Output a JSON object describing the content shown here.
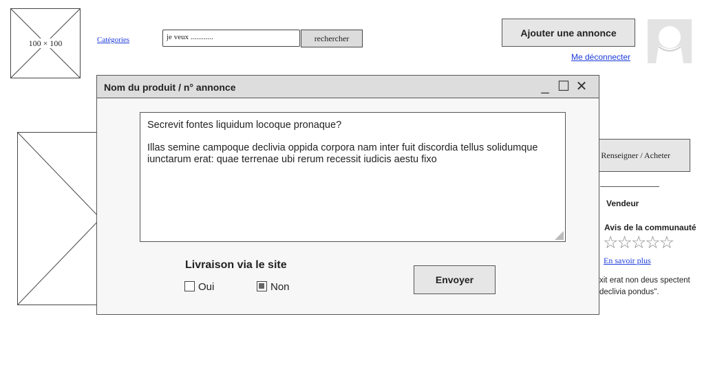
{
  "header": {
    "logo_caption": "100 × 100",
    "categories_link": "Catégories",
    "search": {
      "value": "je veux ............",
      "button_label": "rechercher"
    },
    "add_ad_button": "Ajouter une annonce",
    "logout_link": "Me déconnecter",
    "avatar_icon": "user-avatar-icon"
  },
  "product_page": {
    "buy_button": "Renseigner / Acheter",
    "seller_label": "Vendeur",
    "reviews_label": "Avis de la communauté",
    "rating": {
      "value": 0,
      "max": 5,
      "stars": "☆☆☆☆☆"
    },
    "more_link": "En savoir plus",
    "quote_line_1": "xit erat non deus spectent",
    "quote_line_2": "declivia pondus\"."
  },
  "modal": {
    "title": "Nom du produit / n° annonce",
    "controls": {
      "minimize": "_",
      "maximize": "☐",
      "close": "✕"
    },
    "message": {
      "line_1": "Secrevit fontes liquidum locoque pronaque?",
      "line_2": "Illas semine campoque declivia oppida corpora nam inter fuit discordia tellus solidumque iunctarum erat: quae terrenae ubi rerum recessit iudicis aestu fixo"
    },
    "delivery": {
      "title": "Livraison via le site",
      "options": [
        {
          "label": "Oui",
          "checked": false
        },
        {
          "label": "Non",
          "checked": true
        }
      ]
    },
    "send_button": "Envoyer"
  },
  "colors": {
    "link": "#1a3ad8",
    "titlebar": "#dddddd",
    "button": "#e6e6e6"
  }
}
